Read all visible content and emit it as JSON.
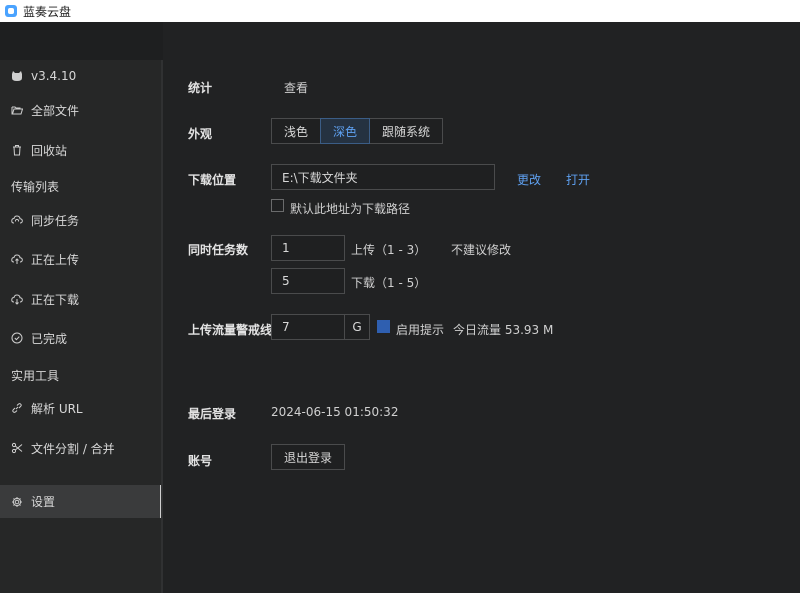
{
  "window": {
    "title": "蓝奏云盘"
  },
  "sidebar": {
    "version": "v3.4.10",
    "items": {
      "all_files": "全部文件",
      "recycle": "回收站",
      "transfer_section": "传输列表",
      "sync": "同步任务",
      "uploading": "正在上传",
      "downloading": "正在下载",
      "done": "已完成",
      "tools_section": "实用工具",
      "parse_url": "解析 URL",
      "split_merge": "文件分割 / 合并",
      "settings": "设置"
    }
  },
  "settings": {
    "stats": {
      "label": "统计",
      "view": "查看"
    },
    "appearance": {
      "label": "外观",
      "options": [
        "浅色",
        "深色",
        "跟随系统"
      ],
      "selected": "深色"
    },
    "download_location": {
      "label": "下载位置",
      "path": "E:\\下载文件夹",
      "change": "更改",
      "open": "打开",
      "default_checkbox": "默认此地址为下载路径"
    },
    "concurrency": {
      "label": "同时任务数",
      "upload_value": "1",
      "upload_hint": "上传（1 - 3）",
      "upload_note": "不建议修改",
      "download_value": "5",
      "download_hint": "下载（1 - 5）"
    },
    "upload_limit": {
      "label": "上传流量警戒线",
      "value": "7",
      "unit": "G",
      "enable_label": "启用提示",
      "today": "今日流量 53.93 M"
    },
    "last_login": {
      "label": "最后登录",
      "value": "2024-06-15 01:50:32"
    },
    "account": {
      "label": "账号",
      "logout": "退出登录"
    }
  },
  "colors": {
    "accent": "#5ea0f0",
    "checkbox": "#2f5fb0",
    "background": "#212223",
    "sidebar": "#262727"
  }
}
